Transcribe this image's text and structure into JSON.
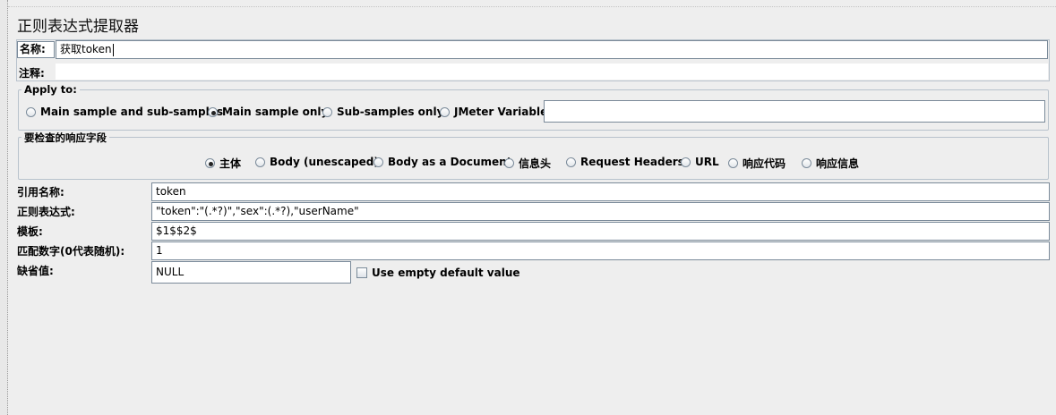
{
  "panel": {
    "title": "正则表达式提取器"
  },
  "name_row": {
    "label": "名称:",
    "value": "获取token"
  },
  "comment_row": {
    "label": "注释:",
    "value": ""
  },
  "apply_to": {
    "legend": "Apply to:",
    "options": [
      {
        "label": "Main sample and sub-samples",
        "selected": false
      },
      {
        "label": "Main sample only",
        "selected": true
      },
      {
        "label": "Sub-samples only",
        "selected": false
      },
      {
        "label": "JMeter Variable",
        "selected": false
      }
    ],
    "variable_value": ""
  },
  "field_to_check": {
    "legend": "要检查的响应字段",
    "options": [
      {
        "label": "主体",
        "selected": true
      },
      {
        "label": "Body (unescaped)",
        "selected": false
      },
      {
        "label": "Body as a Document",
        "selected": false
      },
      {
        "label": "信息头",
        "selected": false
      },
      {
        "label": "Request Headers",
        "selected": false
      },
      {
        "label": "URL",
        "selected": false
      },
      {
        "label": "响应代码",
        "selected": false
      },
      {
        "label": "响应信息",
        "selected": false
      }
    ]
  },
  "form": {
    "reference_name": {
      "label": "引用名称:",
      "value": "token"
    },
    "regex": {
      "label": "正则表达式:",
      "value": "\"token\":\"(.*?)\",\"sex\":(.*?),\"userName\""
    },
    "template": {
      "label": "模板:",
      "value": "$1$$2$"
    },
    "match_no": {
      "label": "匹配数字(0代表随机):",
      "value": "1"
    },
    "default_value": {
      "label": "缺省值:",
      "value": "NULL"
    },
    "use_empty_default": {
      "label": "Use empty default value",
      "checked": false
    }
  }
}
